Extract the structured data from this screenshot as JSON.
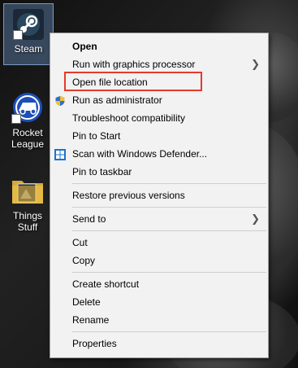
{
  "desktop": {
    "icons": [
      {
        "label": "Steam",
        "icon": "steam-icon"
      },
      {
        "label": "Rocket League",
        "icon": "rocket-league-icon"
      },
      {
        "label": "Things Stuff",
        "icon": "folder-icon"
      }
    ]
  },
  "context_menu": {
    "items": [
      {
        "label": "Open"
      },
      {
        "label": "Run with graphics processor",
        "submenu": true
      },
      {
        "label": "Open file location",
        "highlighted": true
      },
      {
        "label": "Run as administrator",
        "icon": "uac-shield-icon"
      },
      {
        "label": "Troubleshoot compatibility"
      },
      {
        "label": "Pin to Start"
      },
      {
        "label": "Scan with Windows Defender...",
        "icon": "windows-defender-icon"
      },
      {
        "label": "Pin to taskbar"
      },
      {
        "label": "Restore previous versions"
      },
      {
        "label": "Send to",
        "submenu": true
      },
      {
        "label": "Cut"
      },
      {
        "label": "Copy"
      },
      {
        "label": "Create shortcut"
      },
      {
        "label": "Delete"
      },
      {
        "label": "Rename"
      },
      {
        "label": "Properties"
      }
    ]
  },
  "colors": {
    "highlight_box": "#e53a2a",
    "menu_background": "#f2f2f2"
  }
}
